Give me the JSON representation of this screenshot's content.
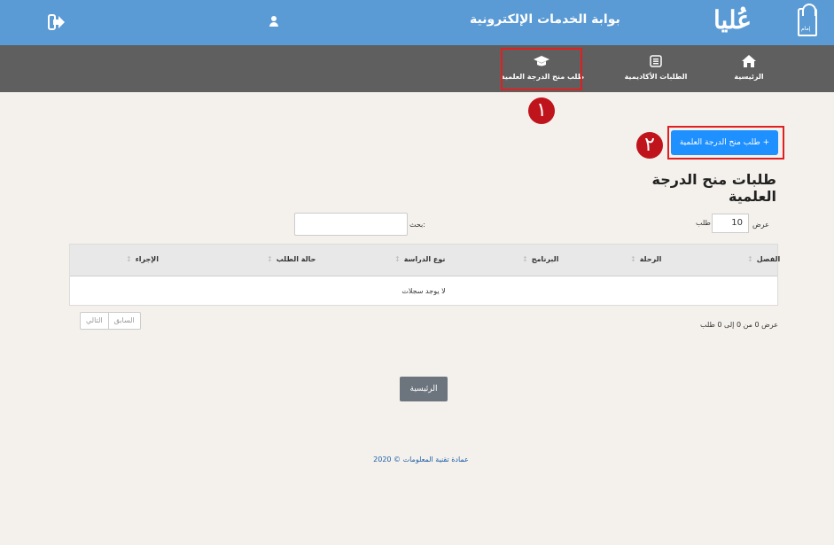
{
  "header": {
    "logo_text": "عُليا",
    "emblem_text": "إمام",
    "portal_title": "بوابة الخدمات الإلكترونية"
  },
  "nav": {
    "home": "الرئيسية",
    "academic_requests": "الطلبات الأكاديمية",
    "degree_request": "طلب منح الدرجة العلمية"
  },
  "markers": {
    "one": "١",
    "two": "٢"
  },
  "add_button": "طلب منح الدرجة العلمية +",
  "page_title": "طلبات منح الدرجة العلمية",
  "table_controls": {
    "show_label": "عرض",
    "length_value": "10",
    "length_suffix": "طلب",
    "search_label": "بحث:"
  },
  "table": {
    "columns": [
      "الفصل",
      "الرحلة",
      "البرنامج",
      "نوع الدراسة",
      "حالة الطلب",
      "الإجراء"
    ],
    "empty_text": "لا يوجد سجلات"
  },
  "info_text": "عرض 0 من 0 إلى 0 طلب",
  "pagination": {
    "previous": "السابق",
    "next": "التالي"
  },
  "home_button": "الرئيسية",
  "footer": "عمادة تقنية المعلومات © 2020",
  "colors": {
    "header_bg": "#5b9bd5",
    "nav_bg": "#5f5f5f",
    "primary": "#1e90ff",
    "highlight": "#e02020"
  }
}
